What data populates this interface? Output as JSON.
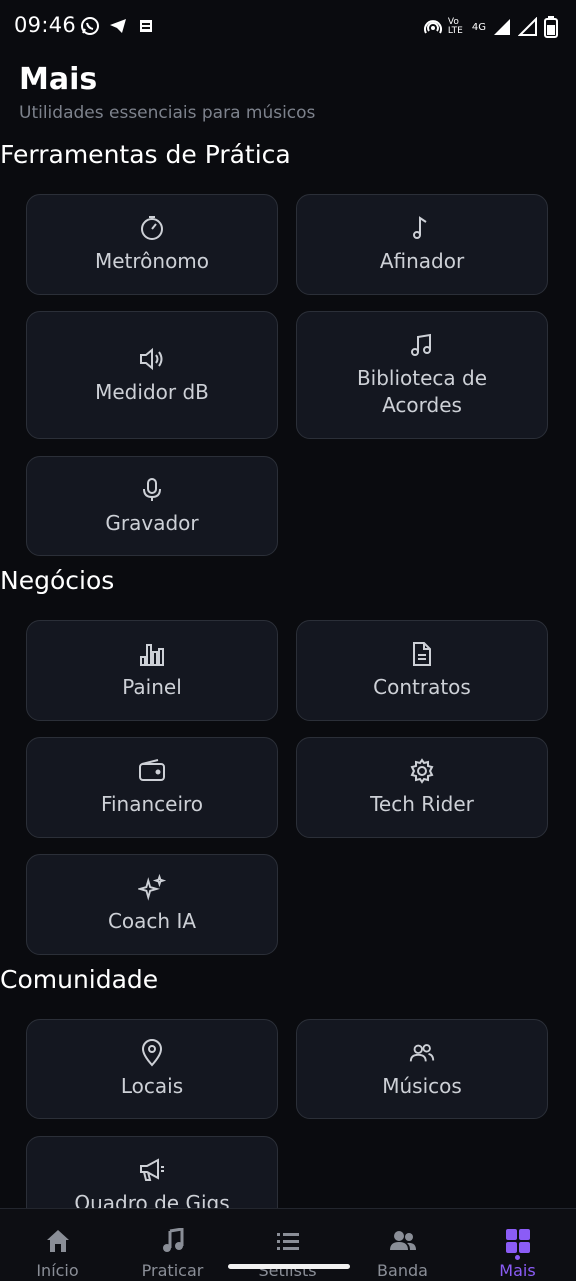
{
  "status_bar": {
    "time": "09:46",
    "left_icons": [
      "whatsapp-icon",
      "telegram-icon",
      "app-icon"
    ],
    "right_icons": [
      "hotspot-icon",
      "volte-icon",
      "signal-icon",
      "signal-icon",
      "battery-icon"
    ],
    "network": "4G",
    "volte_label": "Vo LTE"
  },
  "header": {
    "title": "Mais",
    "subtitle": "Utilidades essenciais para músicos"
  },
  "sections": [
    {
      "title": "Ferramentas de Prática",
      "items": [
        {
          "label": "Metrônomo",
          "icon": "timer-icon"
        },
        {
          "label": "Afinador",
          "icon": "music-note-icon"
        },
        {
          "label": "Medidor dB",
          "icon": "volume-icon"
        },
        {
          "label": "Biblioteca de Acordes",
          "icon": "music-notes-icon"
        },
        {
          "label": "Gravador",
          "icon": "microphone-icon"
        }
      ]
    },
    {
      "title": "Negócios",
      "items": [
        {
          "label": "Painel",
          "icon": "bar-chart-icon"
        },
        {
          "label": "Contratos",
          "icon": "document-icon"
        },
        {
          "label": "Financeiro",
          "icon": "wallet-icon"
        },
        {
          "label": "Tech Rider",
          "icon": "gear-icon"
        },
        {
          "label": "Coach IA",
          "icon": "sparkles-icon"
        }
      ]
    },
    {
      "title": "Comunidade",
      "items": [
        {
          "label": "Locais",
          "icon": "map-pin-icon"
        },
        {
          "label": "Músicos",
          "icon": "users-icon"
        },
        {
          "label": "Quadro de Gigs",
          "icon": "megaphone-icon"
        }
      ]
    }
  ],
  "bottom_nav": {
    "items": [
      {
        "label": "Início",
        "icon": "home-icon"
      },
      {
        "label": "Praticar",
        "icon": "music-note-icon"
      },
      {
        "label": "Setlists",
        "icon": "list-icon"
      },
      {
        "label": "Banda",
        "icon": "users-icon"
      },
      {
        "label": "Mais",
        "icon": "grid-icon"
      }
    ],
    "active": "Mais"
  },
  "colors": {
    "background": "#0a0b0f",
    "card": "#141720",
    "card_border": "#2b2f38",
    "accent": "#8b5cf6",
    "muted_text": "#7d828c"
  }
}
